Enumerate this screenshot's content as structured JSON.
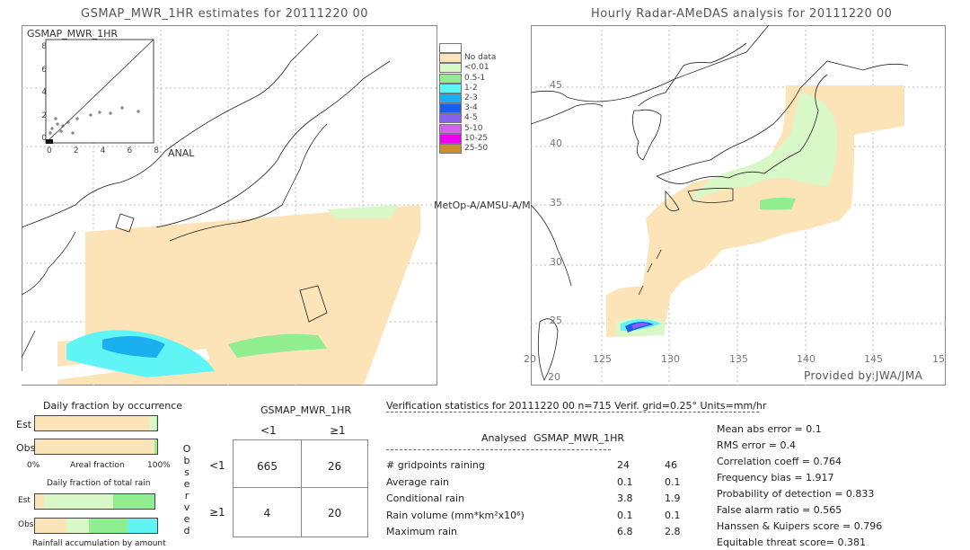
{
  "left_panel": {
    "title": "GSMAP_MWR_1HR estimates for 20111220 00",
    "inset_label": "GSMAP_MWR_1HR",
    "inset_xlabel": "ANAL",
    "inset_ticks": [
      "0",
      "2",
      "4",
      "6",
      "8"
    ],
    "satellite_label": "MetOp-A/AMSU-A/M"
  },
  "right_panel": {
    "title": "Hourly Radar-AMeDAS analysis for 20111220 00",
    "lon_ticks": [
      "20",
      "125",
      "130",
      "135",
      "140",
      "145",
      "15"
    ],
    "lat_ticks": [
      "45",
      "40",
      "35",
      "30",
      "25",
      "20"
    ],
    "credit": "Provided by:JWA/JMA"
  },
  "legend": [
    {
      "label": "",
      "color": "#ffffff"
    },
    {
      "label": "No data",
      "color": "#fde3b8"
    },
    {
      "label": "<0.01",
      "color": "#d8f8c8"
    },
    {
      "label": "0.5-1",
      "color": "#90ee90"
    },
    {
      "label": "1-2",
      "color": "#5ff5f5"
    },
    {
      "label": "2-3",
      "color": "#1ab0f0"
    },
    {
      "label": "3-4",
      "color": "#1a5cf0"
    },
    {
      "label": "4-5",
      "color": "#8a60f0"
    },
    {
      "label": "5-10",
      "color": "#d860f0"
    },
    {
      "label": "10-25",
      "color": "#f000f0"
    },
    {
      "label": "25-50",
      "color": "#c89030"
    }
  ],
  "fractions": {
    "occurrence_title": "Daily fraction by occurrence",
    "est": "Est",
    "obs": "Obs",
    "axis_left": "0%",
    "axis_mid": "Areal fraction",
    "axis_right": "100%",
    "total_title": "Daily fraction of total rain",
    "accum_label": "Rainfall accumulation by amount"
  },
  "contingency": {
    "title": "GSMAP_MWR_1HR",
    "col_headers": [
      "<1",
      "≥1"
    ],
    "row_headers": [
      "<1",
      "≥1"
    ],
    "side_label": [
      "O",
      "b",
      "s",
      "e",
      "r",
      "v",
      "e",
      "d"
    ],
    "cells": [
      [
        "665",
        "26"
      ],
      [
        "4",
        "20"
      ]
    ]
  },
  "stats": {
    "header": "Verification statistics for 20111220 00   n=715   Verif. grid=0.25°   Units=mm/hr",
    "col1": "Analysed",
    "col2": "GSMAP_MWR_1HR",
    "rows": [
      {
        "label": "# gridpoints raining",
        "a": "24",
        "b": "46"
      },
      {
        "label": "Average rain",
        "a": "0.1",
        "b": "0.1"
      },
      {
        "label": "Conditional rain",
        "a": "3.8",
        "b": "1.9"
      },
      {
        "label": "Rain volume (mm*km²x10⁶)",
        "a": "0.1",
        "b": "0.1"
      },
      {
        "label": "Maximum rain",
        "a": "6.8",
        "b": "2.8"
      }
    ],
    "scores": [
      "Mean abs error = 0.1",
      "RMS error = 0.4",
      "Correlation coeff = 0.764",
      "Frequency bias = 1.917",
      "Probability of detection = 0.833",
      "False alarm ratio = 0.565",
      "Hanssen & Kuipers score = 0.796",
      "Equitable threat score= 0.381"
    ]
  },
  "chart_data": {
    "type": "heatmap",
    "maps": [
      "GSMAP_MWR_1HR estimates for 20111220 00",
      "Hourly Radar-AMeDAS analysis for 20111220 00"
    ],
    "lon_range": [
      120,
      150
    ],
    "lat_range": [
      20,
      47
    ],
    "legend_units": "mm/hr",
    "scatter": {
      "xlabel": "ANAL",
      "ylabel": "GSMAP_MWR_1HR",
      "xlim": [
        0,
        8
      ],
      "ylim": [
        0,
        8
      ]
    }
  }
}
